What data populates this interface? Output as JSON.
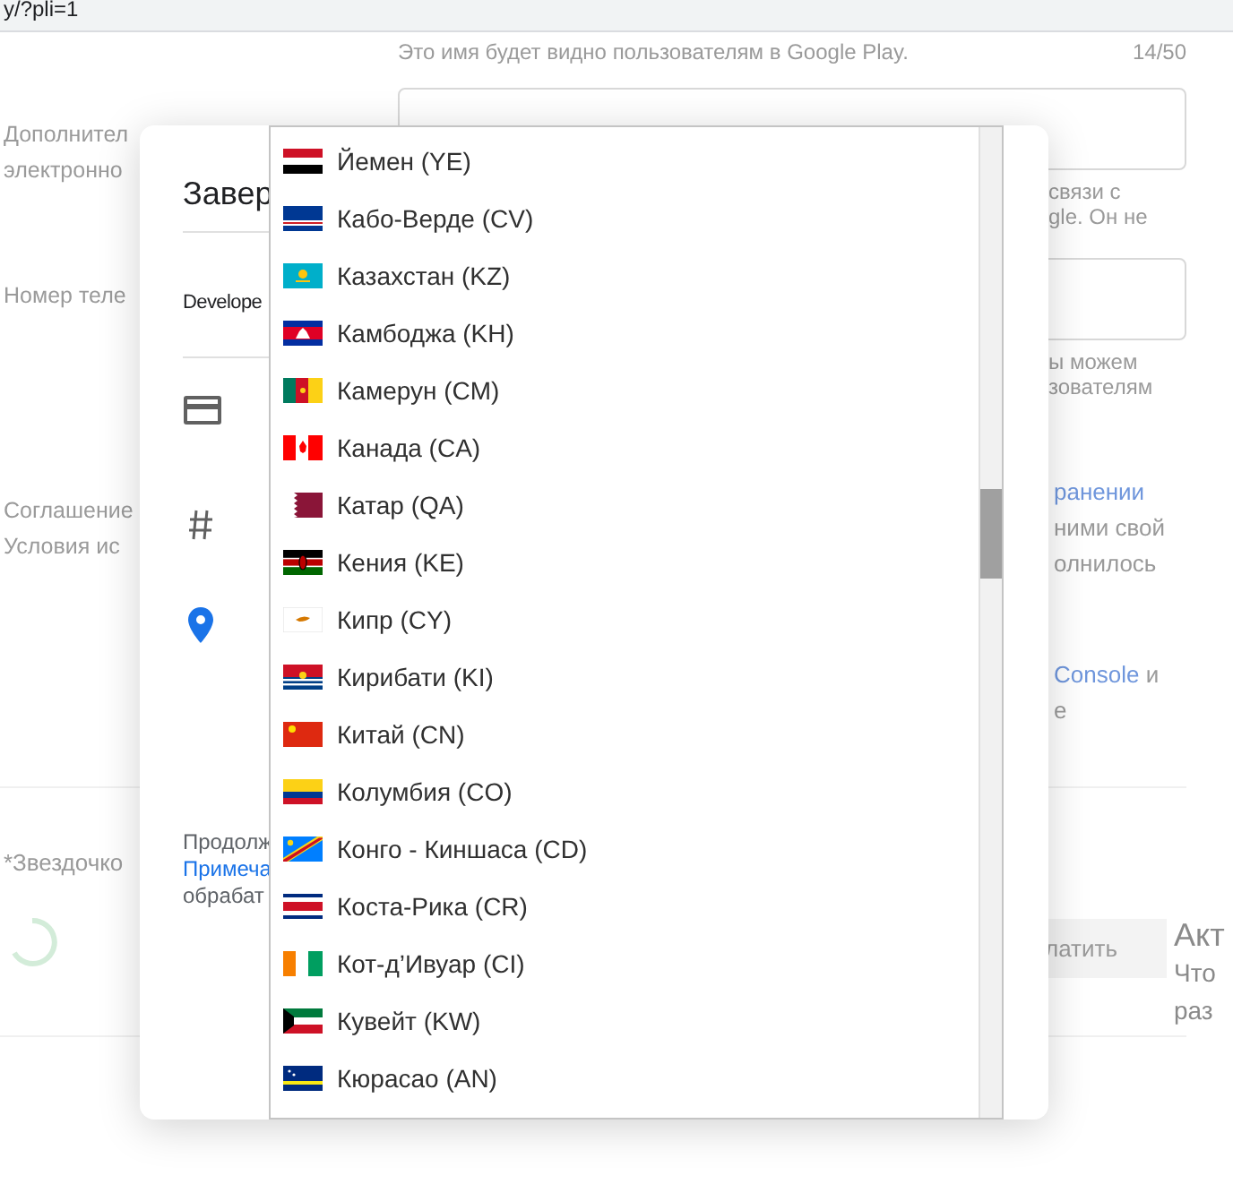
{
  "browser": {
    "url": "y/?pli=1"
  },
  "form": {
    "name_hint": "Это имя будет видно пользователям в Google Play.",
    "name_counter": "14/50",
    "fields": [
      {
        "label_lines": [
          "Дополнител",
          "электронно"
        ],
        "helper_lines": [
          "связи с",
          "gle. Он не"
        ]
      },
      {
        "label_lines": [
          "Номер теле"
        ],
        "helper_lines": [
          "ы можем",
          "зователям"
        ]
      }
    ],
    "agreement": {
      "label_lines": [
        "Соглашение",
        "Условия ис"
      ],
      "lines": [
        [
          {
            "text": "ранении",
            "kind": "link"
          }
        ],
        [
          {
            "text": "ними свой",
            "kind": "plain"
          }
        ],
        [
          {
            "text": "олнилось",
            "kind": "plain"
          }
        ]
      ],
      "console_lines": [
        [
          {
            "text": "Console",
            "kind": "link"
          },
          {
            "text": "и",
            "kind": "plain"
          }
        ],
        [
          {
            "text": "е",
            "kind": "plain"
          }
        ]
      ]
    },
    "required_note": "*Звездочко",
    "pay_button": "латить"
  },
  "side_panel": {
    "title": "Акт",
    "lines": [
      "Что",
      "раз"
    ]
  },
  "dialog": {
    "title": "Завер",
    "account": "Develope",
    "footer_lines": [
      {
        "text": "Продолж",
        "kind": "plain"
      },
      {
        "text": "Примеча",
        "kind": "link"
      },
      {
        "text": "обрабат",
        "kind": "plain"
      }
    ]
  },
  "country_list": {
    "items": [
      {
        "label": "Йемен (YE)"
      },
      {
        "label": "Кабо-Верде (CV)"
      },
      {
        "label": "Казахстан (KZ)"
      },
      {
        "label": "Камбоджа (KH)"
      },
      {
        "label": "Камерун (CM)"
      },
      {
        "label": "Канада (CA)"
      },
      {
        "label": "Катар (QA)"
      },
      {
        "label": "Кения (KE)"
      },
      {
        "label": "Кипр (CY)"
      },
      {
        "label": "Кирибати (KI)"
      },
      {
        "label": "Китай (CN)"
      },
      {
        "label": "Колумбия (CO)"
      },
      {
        "label": "Конго - Киншаса (CD)"
      },
      {
        "label": "Коста-Рика (CR)"
      },
      {
        "label": "Кот-д’Ивуар (CI)"
      },
      {
        "label": "Кувейт (KW)"
      },
      {
        "label": "Кюрасао (AN)"
      }
    ]
  }
}
